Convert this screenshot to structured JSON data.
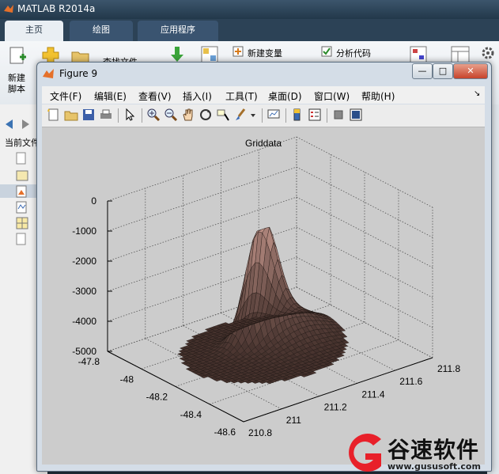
{
  "app": {
    "title": "MATLAB R2014a"
  },
  "tabs": [
    {
      "label": "主页"
    },
    {
      "label": "绘图"
    },
    {
      "label": "应用程序"
    }
  ],
  "ribbon": {
    "new_script": "新建\n脚本",
    "find_files": "查找文件",
    "new_variable": "新建变量",
    "analyze_code": "分析代码"
  },
  "sidebar": {
    "current_folder": "当前文件"
  },
  "figure": {
    "title": "Figure 9",
    "window_buttons": {
      "minimize": "—",
      "maximize": "□",
      "close": "✕"
    },
    "menu": [
      "文件(F)",
      "编辑(E)",
      "查看(V)",
      "插入(I)",
      "工具(T)",
      "桌面(D)",
      "窗口(W)",
      "帮助(H)"
    ],
    "menu_arrow": "↘"
  },
  "chart_data": {
    "type": "surface",
    "title": "Griddata",
    "zlim": [
      -5000,
      0
    ],
    "z_ticks": [
      "0",
      "-1000",
      "-2000",
      "-3000",
      "-4000",
      "-5000"
    ],
    "x_ticks": [
      "-47.8",
      "-48",
      "-48.2",
      "-48.4",
      "-48.6"
    ],
    "y_ticks": [
      "210.8",
      "211",
      "211.2",
      "211.4",
      "211.6",
      "211.8"
    ],
    "peak": {
      "x": -48.15,
      "y": 211.3,
      "z": -1000
    },
    "base_z": -4700,
    "grid": true,
    "colormap": "copper"
  },
  "watermark": {
    "text": "谷速软件",
    "url": "www.gususoft.com",
    "accent": "#e8202a"
  }
}
